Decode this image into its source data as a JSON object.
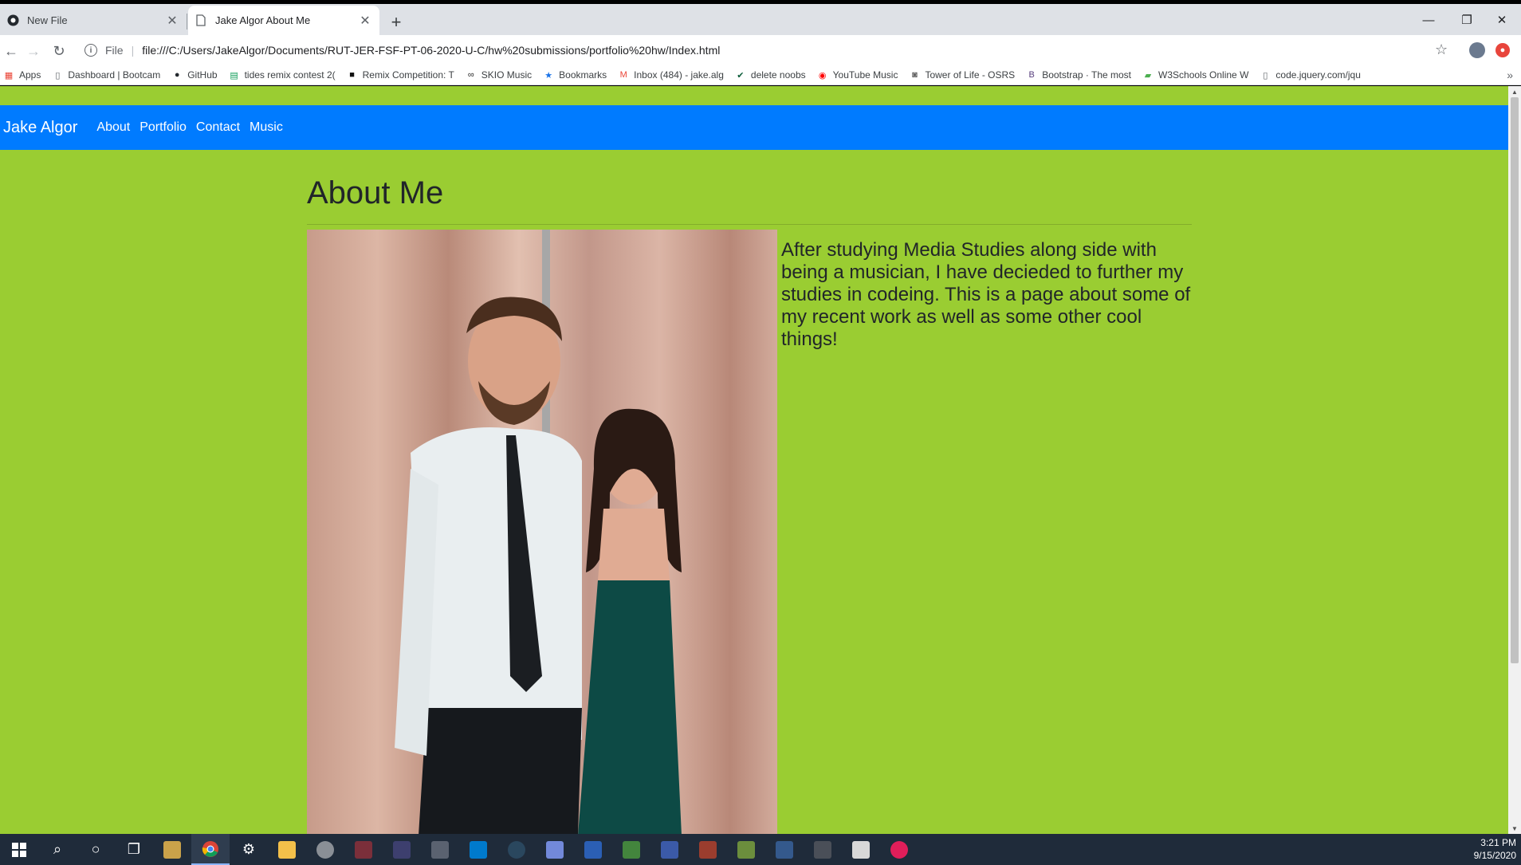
{
  "browser": {
    "tabs": [
      {
        "title": "New File",
        "active": false
      },
      {
        "title": "Jake Algor About Me",
        "active": true
      }
    ],
    "omnibox": {
      "scheme_label": "File",
      "url": "file:///C:/Users/JakeAlgor/Documents/RUT-JER-FSF-PT-06-2020-U-C/hw%20submissions/portfolio%20hw/Index.html"
    },
    "bookmarks": [
      {
        "label": "Apps",
        "icon": "apps-grid-icon"
      },
      {
        "label": "Dashboard | Bootcam",
        "icon": "page-icon"
      },
      {
        "label": "GitHub",
        "icon": "github-icon"
      },
      {
        "label": "tides remix contest 2(",
        "icon": "sheets-icon"
      },
      {
        "label": "Remix Competition: T",
        "icon": "remix-icon"
      },
      {
        "label": "SKIO Music",
        "icon": "skio-icon"
      },
      {
        "label": "Bookmarks",
        "icon": "star-icon"
      },
      {
        "label": "Inbox (484) - jake.alg",
        "icon": "gmail-icon"
      },
      {
        "label": "delete noobs",
        "icon": "check-icon"
      },
      {
        "label": "YouTube Music",
        "icon": "youtube-music-icon"
      },
      {
        "label": "Tower of Life - OSRS",
        "icon": "osrs-icon"
      },
      {
        "label": "Bootstrap · The most",
        "icon": "bootstrap-icon"
      },
      {
        "label": "W3Schools Online W",
        "icon": "w3schools-icon"
      },
      {
        "label": "code.jquery.com/jqu",
        "icon": "page-icon"
      }
    ]
  },
  "page": {
    "brand": "Jake Algor",
    "nav": [
      "About",
      "Portfolio",
      "Contact",
      "Music"
    ],
    "title": "About Me",
    "bio": "After studying Media Studies along side with being a musician, I have decieded to further my studies in codeing. This is a page about some of my recent work as well as some other cool things!",
    "background_color": "#9acd32",
    "navbar_color": "#007bff"
  },
  "taskbar": {
    "time": "3:21 PM",
    "date": "9/15/2020"
  }
}
